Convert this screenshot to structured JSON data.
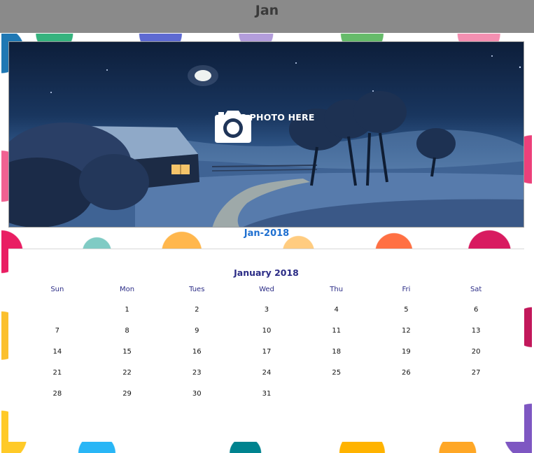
{
  "topbar": {
    "title": "Jan"
  },
  "photo": {
    "drop_label": "DRAG PHOTO HERE",
    "icon": "camera-icon"
  },
  "caption": {
    "month_year": "Jan-2018"
  },
  "calendar": {
    "title": "January 2018",
    "weekdays": [
      "Sun",
      "Mon",
      "Tues",
      "Wed",
      "Thu",
      "Fri",
      "Sat"
    ],
    "weeks": [
      [
        "",
        "1",
        "2",
        "3",
        "4",
        "5",
        "6"
      ],
      [
        "7",
        "8",
        "9",
        "10",
        "11",
        "12",
        "13"
      ],
      [
        "14",
        "15",
        "16",
        "17",
        "18",
        "19",
        "20"
      ],
      [
        "21",
        "22",
        "23",
        "24",
        "25",
        "26",
        "27"
      ],
      [
        "28",
        "29",
        "30",
        "31",
        "",
        "",
        ""
      ]
    ]
  },
  "colors": {
    "topbar": "#8a8a8a",
    "caption": "#1e6fd0",
    "calendar_header": "#2b2c86"
  }
}
